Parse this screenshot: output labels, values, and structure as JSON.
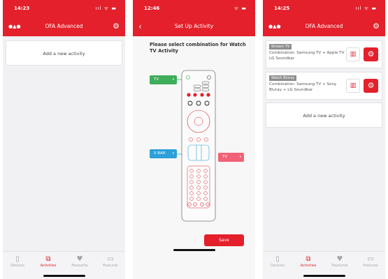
{
  "screen1": {
    "time": "14:23",
    "signal": "ııl ᯤ ▬",
    "title": "OFA Advanced",
    "add_activity": "Add a new activity"
  },
  "screen2": {
    "time": "12:46",
    "signal": "ᯤ ▬",
    "title": "Set Up Activity",
    "prompt": "Please select combination for Watch TV Activity",
    "selector_top": "TV",
    "selector_mid": "S BAR",
    "selector_right": "TV",
    "save_label": "Save"
  },
  "screen3": {
    "time": "14:25",
    "signal": "ııl ᯤ ▬",
    "title": "OFA Advanced",
    "activities": [
      {
        "tag": "Stream TV",
        "desc": "Combination: Samsung TV + Apple TV + LG Soundbar"
      },
      {
        "tag": "Watch Bluray",
        "desc": "Combination: Samsung TV + Sony Bluray + LG Soundbar"
      }
    ],
    "add_activity": "Add a new activity"
  },
  "tabs": [
    {
      "label": "Devices",
      "icon": "remote-icon"
    },
    {
      "label": "Activities",
      "icon": "activities-icon"
    },
    {
      "label": "Favourite",
      "icon": "heart-icon"
    },
    {
      "label": "Features",
      "icon": "features-icon"
    }
  ],
  "colors": {
    "accent": "#e3202b",
    "green": "#3fae5a",
    "blue": "#2d9fd9",
    "pink": "#f06277"
  }
}
